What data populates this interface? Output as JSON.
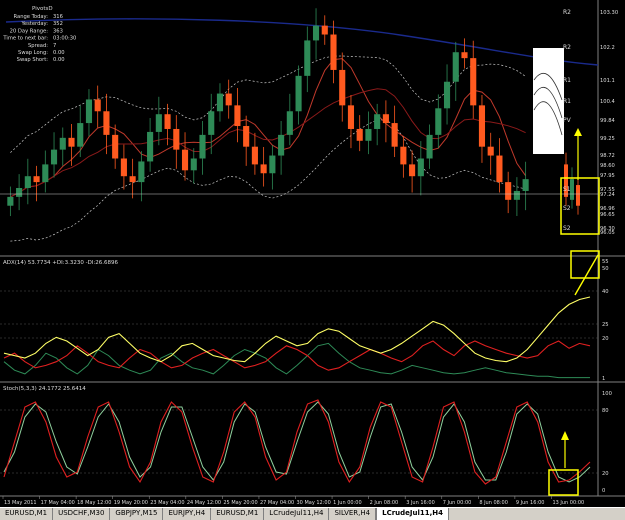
{
  "info_panel": {
    "title": "PivotsD",
    "rows": [
      {
        "label": "Range  Today:",
        "value": "316"
      },
      {
        "label": "Yesterday:",
        "value": "352"
      },
      {
        "label": "20 Day Range:",
        "value": "363"
      },
      {
        "label": "Time to next bar:",
        "value": "03:00:30"
      },
      {
        "label": "Spread:",
        "value": "7"
      },
      {
        "label": "Swap  Long:",
        "value": "0.00"
      },
      {
        "label": "Swap  Short:",
        "value": "0.00"
      }
    ]
  },
  "price_levels": [
    {
      "label": "R2",
      "value": "103.30"
    },
    {
      "label": "R2",
      "value": "102.2"
    },
    {
      "label": "R1",
      "value": "101.1"
    },
    {
      "label": "R1",
      "value": "100.4"
    },
    {
      "label": "PV",
      "value": "99.84"
    },
    {
      "label": "",
      "value": "99.25"
    },
    {
      "label": "",
      "value": "98.72"
    },
    {
      "label": "",
      "value": "98.60"
    },
    {
      "label": "",
      "value": "97.95"
    },
    {
      "label": "S1",
      "value": "97.55"
    },
    {
      "label": "",
      "value": "97.24"
    },
    {
      "label": "S2",
      "value": "96.96"
    },
    {
      "label": "",
      "value": "96.65"
    },
    {
      "label": "S2",
      "value": "96.30"
    },
    {
      "label": "",
      "value": "96.05"
    }
  ],
  "adx_panel": {
    "title": "ADX(14) 53.7734 +DI:3.3230 -DI:26.6896",
    "scale": [
      "55",
      "50",
      "40",
      "25",
      "20",
      "1"
    ]
  },
  "stoch_panel": {
    "title": "Stoch(5,3,3) 24.1772 25.6414",
    "scale": [
      "100",
      "80",
      "20",
      "0"
    ]
  },
  "time_labels": [
    "13 May 2011",
    "17 May 04:00",
    "18 May 12:00",
    "19 May 20:00",
    "23 May 04:00",
    "24 May 12:00",
    "25 May 20:00",
    "27 May 04:00",
    "30 May 12:00",
    "1 Jun 00:00",
    "2 Jun 08:00",
    "3 Jun 16:00",
    "7 Jun 00:00",
    "8 Jun 08:00",
    "9 Jun 16:00",
    "13 Jun 00:00"
  ],
  "tabs": [
    {
      "label": "EURUSD,M1",
      "active": false
    },
    {
      "label": "USDCHF,M30",
      "active": false
    },
    {
      "label": "GBPJPY,M15",
      "active": false
    },
    {
      "label": "EURJPY,H4",
      "active": false
    },
    {
      "label": "EURUSD,M1",
      "active": false
    },
    {
      "label": "LCrudeJul11,H4",
      "active": false
    },
    {
      "label": "SILVER,H4",
      "active": false
    },
    {
      "label": "LCrudeJul11,H4",
      "active": true
    }
  ],
  "colors": {
    "background": "#000000",
    "bull_candle": "#2e8b57",
    "bear_candle": "#ff5a1f",
    "ma_red": "#c0392b",
    "ma_blue": "#1a2a8c",
    "bands": "#c8c8c8",
    "adx_line": "#ffff66",
    "di_plus": "#2e8b57",
    "di_minus": "#e02020",
    "stoch_main": "#e02020",
    "stoch_signal": "#8fd19e",
    "highlight": "#ffff00"
  },
  "series_shapes": {
    "close": [
      97.3,
      97.6,
      98.0,
      97.8,
      98.4,
      98.9,
      99.3,
      99.0,
      99.8,
      100.6,
      100.2,
      99.4,
      98.6,
      98.0,
      97.8,
      98.5,
      99.5,
      100.1,
      99.6,
      98.9,
      98.2,
      98.6,
      99.4,
      100.2,
      100.8,
      100.4,
      99.7,
      99.0,
      98.4,
      98.1,
      98.7,
      99.4,
      100.2,
      101.4,
      102.6,
      103.1,
      102.8,
      101.6,
      100.4,
      99.6,
      99.2,
      99.6,
      100.1,
      99.8,
      99.0,
      98.4,
      98.0,
      98.6,
      99.4,
      100.3,
      101.2,
      102.2,
      102.0,
      100.4,
      99.0,
      98.7,
      97.8,
      97.2,
      97.5,
      97.9
    ],
    "adx": [
      0.22,
      0.2,
      0.18,
      0.22,
      0.3,
      0.35,
      0.32,
      0.26,
      0.2,
      0.25,
      0.35,
      0.38,
      0.3,
      0.22,
      0.18,
      0.15,
      0.2,
      0.28,
      0.3,
      0.25,
      0.2,
      0.18,
      0.16,
      0.15,
      0.22,
      0.3,
      0.36,
      0.32,
      0.28,
      0.3,
      0.38,
      0.42,
      0.4,
      0.34,
      0.28,
      0.25,
      0.22,
      0.25,
      0.3,
      0.36,
      0.42,
      0.48,
      0.45,
      0.38,
      0.3,
      0.22,
      0.18,
      0.16,
      0.15,
      0.18,
      0.25,
      0.35,
      0.45,
      0.55,
      0.62,
      0.66,
      0.68
    ],
    "di_plus": [
      0.15,
      0.08,
      0.05,
      0.12,
      0.22,
      0.18,
      0.1,
      0.05,
      0.12,
      0.25,
      0.2,
      0.12,
      0.08,
      0.05,
      0.08,
      0.18,
      0.22,
      0.15,
      0.1,
      0.08,
      0.05,
      0.12,
      0.2,
      0.25,
      0.22,
      0.18,
      0.1,
      0.05,
      0.12,
      0.2,
      0.28,
      0.3,
      0.22,
      0.15,
      0.1,
      0.08,
      0.06,
      0.05,
      0.08,
      0.12,
      0.1,
      0.08,
      0.06,
      0.05,
      0.06,
      0.08,
      0.1,
      0.08,
      0.06,
      0.05,
      0.04,
      0.03,
      0.03,
      0.02,
      0.02,
      0.02,
      0.02
    ],
    "di_minus": [
      0.18,
      0.22,
      0.15,
      0.1,
      0.12,
      0.15,
      0.2,
      0.28,
      0.22,
      0.15,
      0.12,
      0.1,
      0.18,
      0.25,
      0.22,
      0.15,
      0.1,
      0.12,
      0.18,
      0.22,
      0.25,
      0.2,
      0.15,
      0.1,
      0.12,
      0.15,
      0.22,
      0.28,
      0.25,
      0.2,
      0.12,
      0.08,
      0.1,
      0.15,
      0.2,
      0.25,
      0.22,
      0.18,
      0.15,
      0.2,
      0.28,
      0.32,
      0.25,
      0.2,
      0.28,
      0.32,
      0.28,
      0.25,
      0.22,
      0.2,
      0.18,
      0.2,
      0.28,
      0.32,
      0.26,
      0.3,
      0.28
    ],
    "stoch_k": [
      0.15,
      0.5,
      0.85,
      0.9,
      0.7,
      0.35,
      0.15,
      0.2,
      0.55,
      0.85,
      0.9,
      0.6,
      0.25,
      0.1,
      0.3,
      0.7,
      0.9,
      0.8,
      0.45,
      0.15,
      0.1,
      0.4,
      0.8,
      0.9,
      0.75,
      0.35,
      0.12,
      0.2,
      0.6,
      0.88,
      0.92,
      0.7,
      0.3,
      0.1,
      0.25,
      0.65,
      0.9,
      0.85,
      0.5,
      0.15,
      0.1,
      0.45,
      0.85,
      0.9,
      0.6,
      0.2,
      0.08,
      0.15,
      0.5,
      0.85,
      0.9,
      0.7,
      0.3,
      0.1,
      0.12,
      0.2,
      0.3
    ],
    "stoch_d": [
      0.2,
      0.4,
      0.75,
      0.88,
      0.8,
      0.5,
      0.25,
      0.18,
      0.45,
      0.75,
      0.88,
      0.7,
      0.35,
      0.15,
      0.25,
      0.6,
      0.85,
      0.85,
      0.55,
      0.25,
      0.12,
      0.3,
      0.7,
      0.88,
      0.8,
      0.45,
      0.2,
      0.18,
      0.5,
      0.8,
      0.9,
      0.78,
      0.4,
      0.15,
      0.2,
      0.55,
      0.85,
      0.88,
      0.6,
      0.25,
      0.12,
      0.35,
      0.75,
      0.88,
      0.7,
      0.3,
      0.12,
      0.12,
      0.4,
      0.78,
      0.88,
      0.78,
      0.4,
      0.15,
      0.1,
      0.15,
      0.25
    ]
  }
}
